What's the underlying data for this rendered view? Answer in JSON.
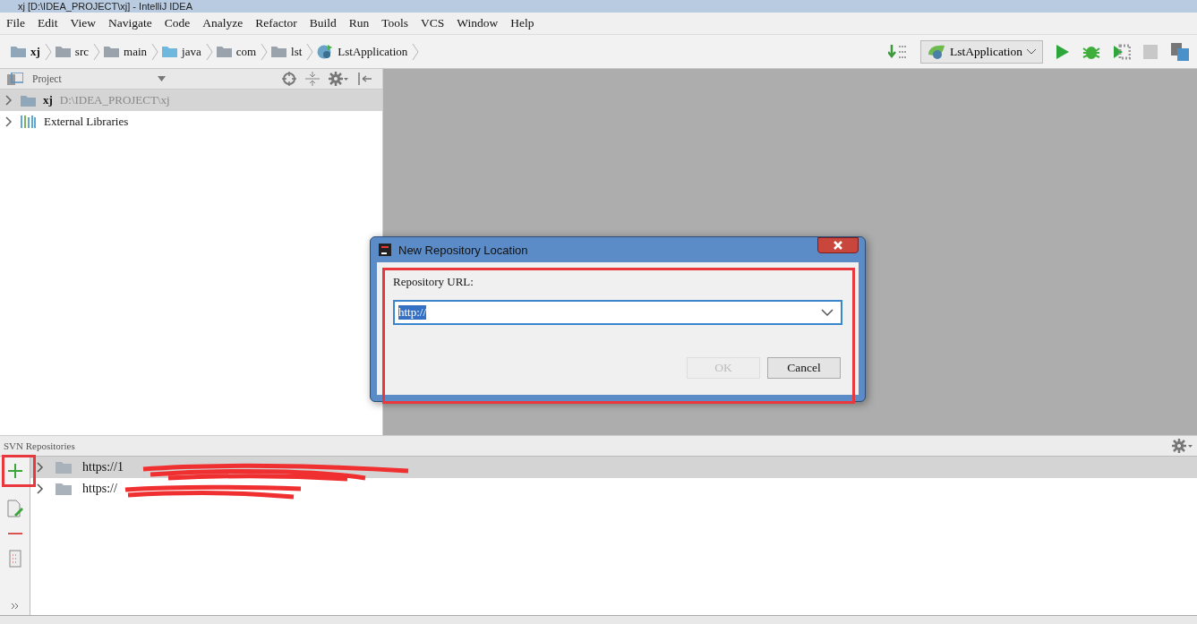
{
  "window": {
    "title": "xj [D:\\IDEA_PROJECT\\xj] - IntelliJ IDEA"
  },
  "menu": [
    "File",
    "Edit",
    "View",
    "Navigate",
    "Code",
    "Analyze",
    "Refactor",
    "Build",
    "Run",
    "Tools",
    "VCS",
    "Window",
    "Help"
  ],
  "breadcrumbs": [
    {
      "label": "xj",
      "kind": "module"
    },
    {
      "label": "src",
      "kind": "folder"
    },
    {
      "label": "main",
      "kind": "folder"
    },
    {
      "label": "java",
      "kind": "source"
    },
    {
      "label": "com",
      "kind": "package"
    },
    {
      "label": "lst",
      "kind": "package"
    },
    {
      "label": "LstApplication",
      "kind": "class"
    }
  ],
  "run_config": {
    "label": "LstApplication"
  },
  "project_panel": {
    "title": "Project",
    "items": [
      {
        "name": "xj",
        "path": "D:\\IDEA_PROJECT\\xj",
        "kind": "module",
        "selected": true
      },
      {
        "name": "External Libraries",
        "kind": "library",
        "selected": false
      }
    ]
  },
  "dialog": {
    "title": "New Repository Location",
    "label": "Repository URL:",
    "value": "http://",
    "buttons": [
      {
        "label": "OK",
        "disabled": true
      },
      {
        "label": "Cancel",
        "disabled": false
      }
    ]
  },
  "svn_panel": {
    "title": "SVN Repositories",
    "items": [
      {
        "url": "https://1",
        "selected": true
      },
      {
        "url": "https://",
        "selected": false
      }
    ]
  }
}
